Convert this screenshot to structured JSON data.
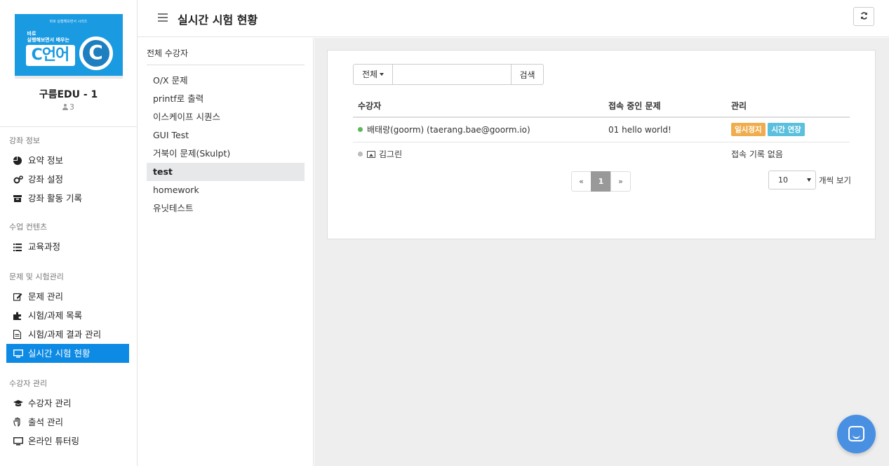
{
  "course": {
    "thumb_topline": "바로 실행해보면서 시리즈",
    "thumb_sub1": "바로",
    "thumb_sub2": "실행해보면서 배우는",
    "thumb_big": "C언어",
    "thumb_logo": "C",
    "title": "구름EDU - 1",
    "count": "3"
  },
  "sidebar": {
    "sections": [
      {
        "heading": "강좌 정보",
        "items": [
          {
            "label": "요약 정보",
            "icon": "pie-chart-icon"
          },
          {
            "label": "강좌 설정",
            "icon": "gears-icon"
          },
          {
            "label": "강좌 활동 기록",
            "icon": "archive-icon"
          }
        ]
      },
      {
        "heading": "수업 컨텐츠",
        "items": [
          {
            "label": "교육과정",
            "icon": "list-icon"
          }
        ]
      },
      {
        "heading": "문제 및 시험관리",
        "items": [
          {
            "label": "문제 관리",
            "icon": "edit-icon"
          },
          {
            "label": "시험/과제 목록",
            "icon": "puzzle-icon"
          },
          {
            "label": "시험/과제 결과 관리",
            "icon": "file-text-icon"
          },
          {
            "label": "실시간 시험 현황",
            "icon": "monitor-icon"
          }
        ]
      },
      {
        "heading": "수강자 관리",
        "items": [
          {
            "label": "수강자 관리",
            "icon": "graduation-cap-icon"
          },
          {
            "label": "출석 관리",
            "icon": "hand-icon"
          },
          {
            "label": "온라인 튜터링",
            "icon": "monitor-icon"
          }
        ]
      }
    ]
  },
  "header": {
    "title": "실시간 시험 현황",
    "refresh_icon": "refresh-icon"
  },
  "mid": {
    "heading": "전체 수강자",
    "items": [
      "O/X 문제",
      "printf로 출력",
      "이스케이프 시퀀스",
      "GUI Test",
      "거북이 문제(Skulpt)",
      "test",
      "homework",
      "유닛테스트"
    ],
    "active": "test"
  },
  "search": {
    "filter_label": "전체",
    "input_value": "",
    "input_placeholder": "",
    "button_label": "검색"
  },
  "table": {
    "headers": [
      "수강자",
      "접속 중인 문제",
      "관리"
    ],
    "rows": [
      {
        "name": "배태랑(goorm) (taerang.bae@goorm.io)",
        "status": "online",
        "problem": "01 hello world!",
        "actions": [
          "일시정지",
          "시간 연장"
        ]
      },
      {
        "name": "김그린",
        "status": "offline",
        "problem": "",
        "note": "접속 기록 없음"
      }
    ]
  },
  "pagination": {
    "prev": "«",
    "current": "1",
    "next": "»"
  },
  "per_page": {
    "value": "10",
    "label": "개씩 보기"
  },
  "colors": {
    "accent": "#0d8ae4",
    "pause": "#f0ad4e",
    "extend": "#5bc0de",
    "online": "#5cb85c",
    "chat": "#4a90e2"
  }
}
